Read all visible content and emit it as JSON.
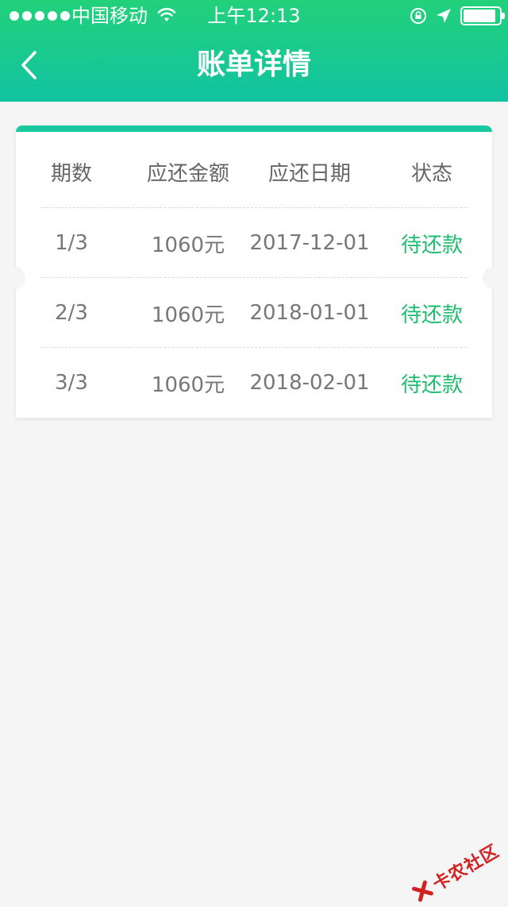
{
  "status_bar": {
    "carrier": "中国移动",
    "time": "上午12:13",
    "battery_level": 0.9
  },
  "nav": {
    "title": "账单详情"
  },
  "table": {
    "headers": [
      "期数",
      "应还金额",
      "应还日期",
      "状态"
    ],
    "rows": [
      {
        "period": "1/3",
        "amount": "1060元",
        "date": "2017-12-01",
        "status": "待还款"
      },
      {
        "period": "2/3",
        "amount": "1060元",
        "date": "2018-01-01",
        "status": "待还款"
      },
      {
        "period": "3/3",
        "amount": "1060元",
        "date": "2018-02-01",
        "status": "待还款"
      }
    ]
  },
  "colors": {
    "header_top": "#22d17a",
    "header_bottom": "#12c3a2",
    "status_green": "#1ebc6e",
    "background": "#f5f5f5"
  },
  "watermark": {
    "text": "卡农社区"
  }
}
